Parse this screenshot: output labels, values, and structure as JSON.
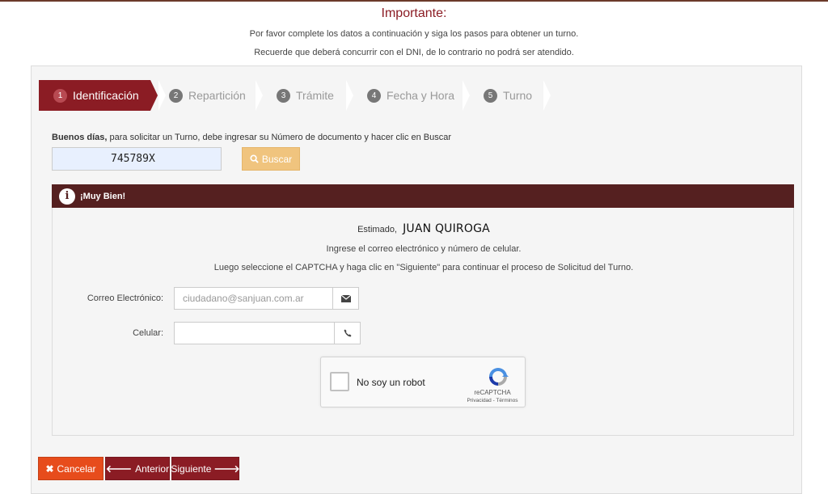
{
  "notice": {
    "title": "Importante:",
    "line1": "Por favor complete los datos a continuación y siga los pasos para obtener un turno.",
    "line2": "Recuerde que deberá concurrir con el DNI, de lo contrario no podrá ser atendido."
  },
  "steps": [
    {
      "num": "1",
      "label": "Identificación",
      "active": true
    },
    {
      "num": "2",
      "label": "Repartición",
      "active": false
    },
    {
      "num": "3",
      "label": "Trámite",
      "active": false
    },
    {
      "num": "4",
      "label": "Fecha y Hora",
      "active": false
    },
    {
      "num": "5",
      "label": "Turno",
      "active": false
    }
  ],
  "identify": {
    "greeting_bold": "Buenos días,",
    "greeting_text": " para solicitar un Turno, debe ingresar su Número de documento y hacer clic en Buscar",
    "dni_value": "745789X",
    "search_label": "Buscar"
  },
  "alert": {
    "title": "¡Muy Bien!",
    "estimado": "Estimado,",
    "name": "JUAN QUIROGA",
    "instruction1": "Ingrese el correo electrónico y número de celular.",
    "instruction2": "Luego seleccione el CAPTCHA y haga clic en \"Siguiente\" para continuar el proceso de Solicitud del Turno."
  },
  "form": {
    "email_label": "Correo Electrónico:",
    "email_placeholder": "ciudadano@sanjuan.com.ar",
    "phone_label": "Celular:",
    "phone_value": ""
  },
  "captcha": {
    "label": "No soy un robot",
    "brand": "reCAPTCHA",
    "links": "Privacidad - Términos"
  },
  "actions": {
    "cancel": "Cancelar",
    "previous": "Anterior",
    "next": "Siguiente"
  },
  "colors": {
    "primary": "#8b1c24",
    "alert_header": "#552020",
    "cancel": "#e74c1c",
    "search": "#f0c47e"
  }
}
